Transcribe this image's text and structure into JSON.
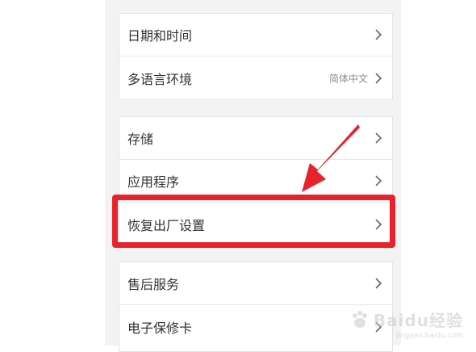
{
  "settings": {
    "group1": {
      "items": [
        {
          "label": "日期和时间",
          "value": ""
        },
        {
          "label": "多语言环境",
          "value": "简体中文"
        }
      ]
    },
    "group2": {
      "items": [
        {
          "label": "存储",
          "value": ""
        },
        {
          "label": "应用程序",
          "value": ""
        },
        {
          "label": "恢复出厂设置",
          "value": ""
        }
      ]
    },
    "group3": {
      "items": [
        {
          "label": "售后服务",
          "value": ""
        },
        {
          "label": "电子保修卡",
          "value": ""
        }
      ]
    }
  },
  "annotation": {
    "highlight_color": "#e8222b",
    "arrow_icon": "red-arrow-icon"
  },
  "watermark": {
    "brand": "Baidu经验",
    "sub": "jingyan.baidu.com"
  }
}
